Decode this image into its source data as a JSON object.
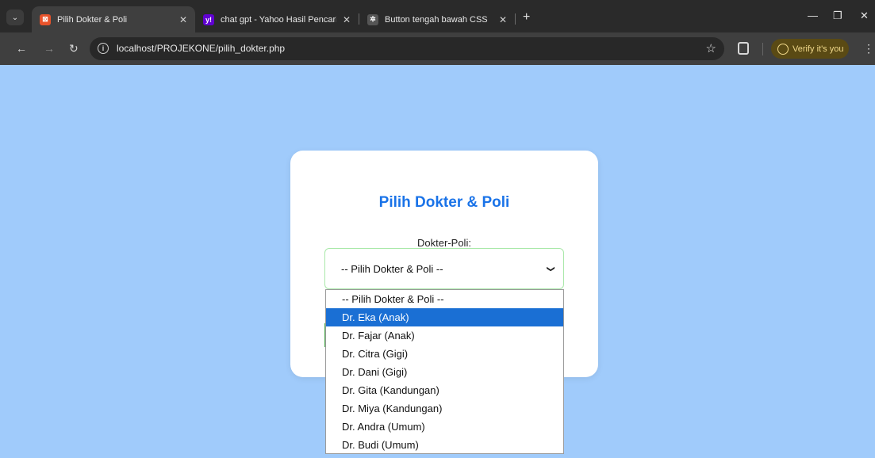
{
  "browser": {
    "tabs": [
      {
        "title": "Pilih Dokter & Poli",
        "favicon_color": "#e8532b",
        "favicon_glyph": "⊠",
        "active": true
      },
      {
        "title": "chat gpt - Yahoo Hasil Pencaria",
        "favicon_color": "#6001d2",
        "favicon_glyph": "y!",
        "active": false
      },
      {
        "title": "Button tengah bawah CSS",
        "favicon_color": "#555555",
        "favicon_glyph": "✲",
        "active": false
      }
    ],
    "url": "localhost/PROJEKONE/pilih_dokter.php",
    "verify_label": "Verify it's you"
  },
  "page": {
    "title": "Pilih Dokter & Poli",
    "field_label": "Dokter-Poli:",
    "select_value": "-- Pilih Dokter & Poli --",
    "options": [
      "-- Pilih Dokter & Poli --",
      "Dr. Eka (Anak)",
      "Dr. Fajar (Anak)",
      "Dr. Citra (Gigi)",
      "Dr. Dani (Gigi)",
      "Dr. Gita (Kandungan)",
      "Dr. Miya (Kandungan)",
      "Dr. Andra (Umum)",
      "Dr. Budi (Umum)"
    ],
    "highlighted_index": 1,
    "colors": {
      "background": "#a0cbfb",
      "title": "#1a73e8",
      "highlight": "#1a6fd4"
    }
  }
}
